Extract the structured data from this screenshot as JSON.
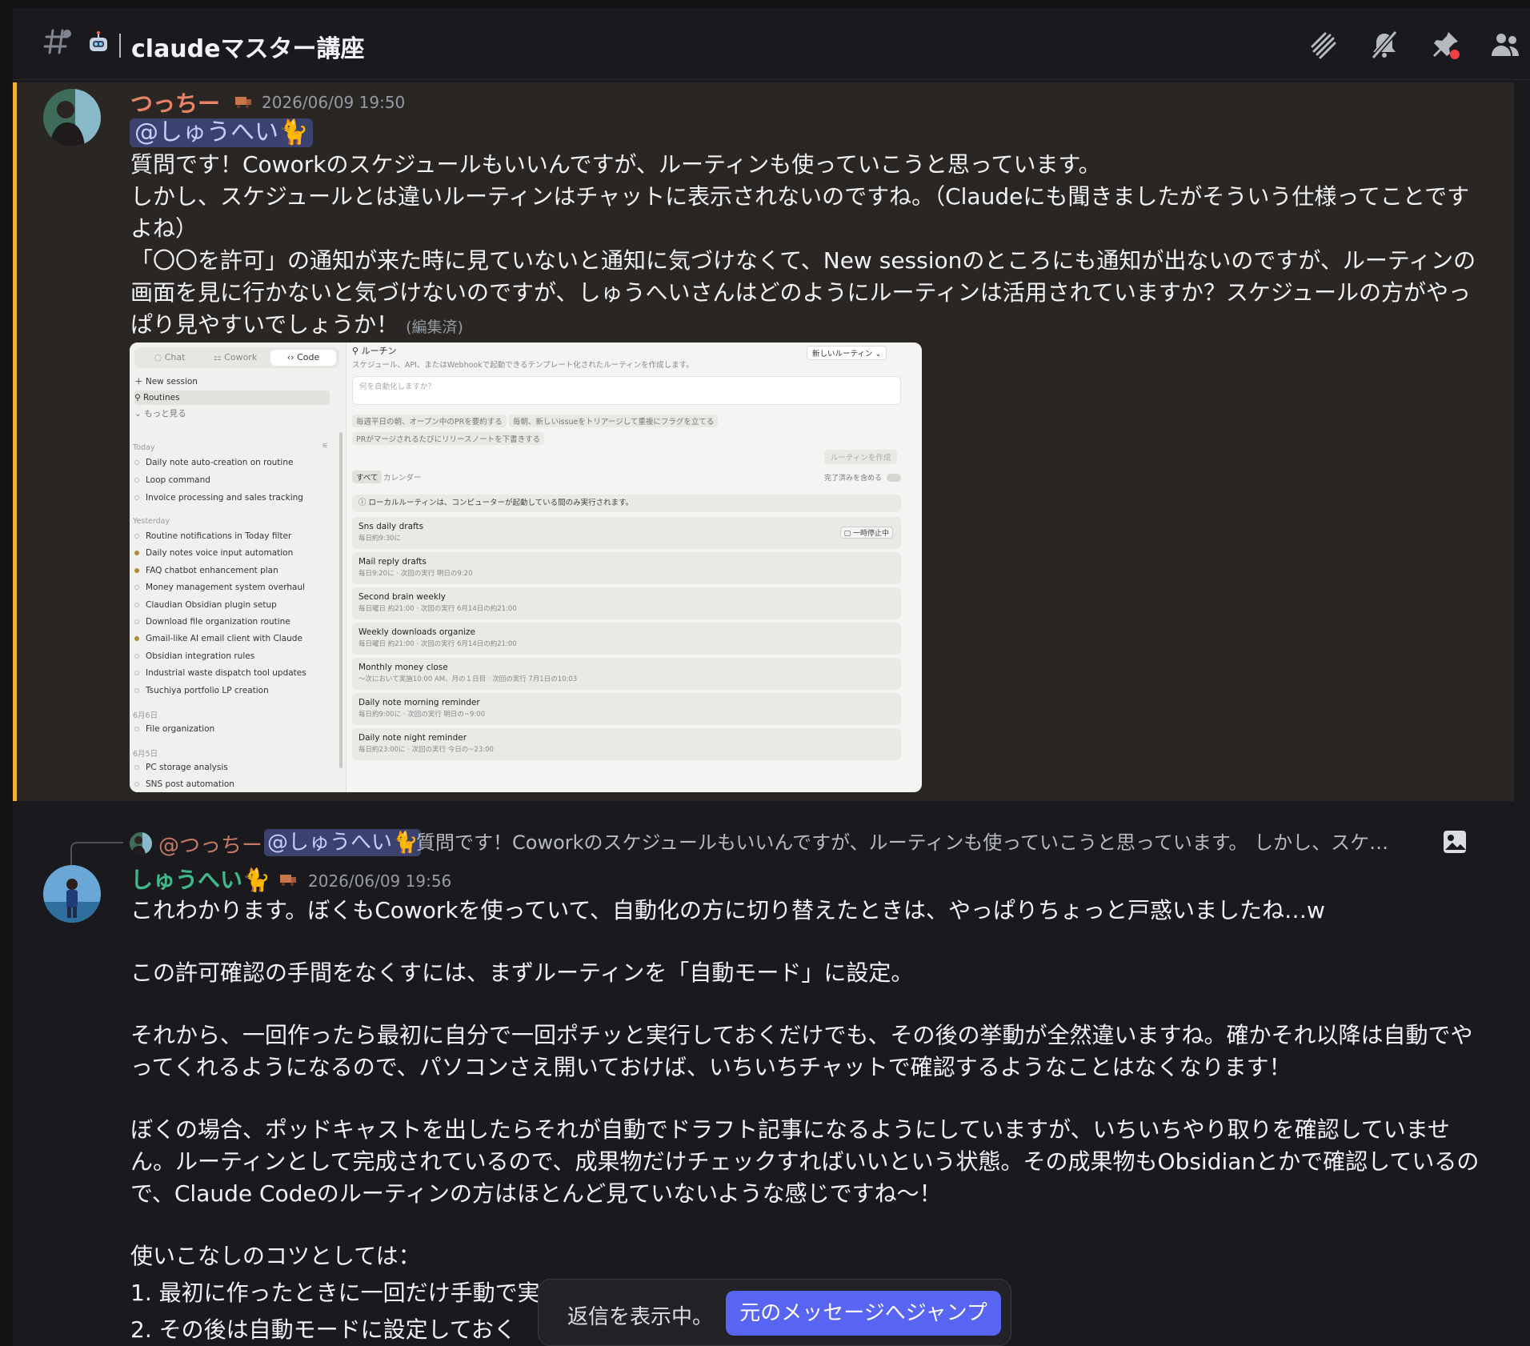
{
  "channel": {
    "name": "claudeマスター講座",
    "icons": [
      "hashtag-icon",
      "robot-icon",
      "threads-icon",
      "mute-icon",
      "pin-icon",
      "members-icon"
    ]
  },
  "message1": {
    "author": "つっちー",
    "timestamp": "2026/06/09 19:50",
    "mention": "@しゅうへい🐈",
    "lines": [
      "質問です！Coworkのスケジュールもいいんですが、ルーティンも使っていこうと思っています。",
      "しかし、スケジュールとは違いルーティンはチャットに表示されないのですね。（Claudeにも聞きましたがそういう仕様ってことですよね）",
      "「〇〇を許可」の通知が来た時に見ていないと通知に気づけなくて、New sessionのところにも通知が出ないのですが、ルーティンの画面を見に行かないと気づけないのですが、しゅうへいさんはどのようにルーティンは活用されていますか？スケジュールの方がやっぱり見やすいでしょうか！"
    ],
    "edited": "(編集済)",
    "accent_color": "#f0b232",
    "author_color": "#e8836a"
  },
  "screenshot": {
    "tabs": [
      "Chat",
      "Cowork",
      "Code"
    ],
    "nav": [
      "New session",
      "Routines",
      "もっと見る"
    ],
    "groups": [
      {
        "label": "Today",
        "items": [
          {
            "name": "Daily note auto-creation on routine",
            "filled": false
          },
          {
            "name": "Loop command",
            "filled": false
          },
          {
            "name": "Invoice processing and sales tracking",
            "filled": false
          }
        ]
      },
      {
        "label": "Yesterday",
        "items": [
          {
            "name": "Routine notifications in Today filter",
            "filled": false
          },
          {
            "name": "Daily notes voice input automation",
            "filled": true
          },
          {
            "name": "FAQ chatbot enhancement plan",
            "filled": true
          },
          {
            "name": "Money management system overhaul",
            "filled": false
          },
          {
            "name": "Claudian Obsidian plugin setup",
            "filled": false
          },
          {
            "name": "Download file organization routine",
            "filled": false
          },
          {
            "name": "Gmail-like AI email client with Claude",
            "filled": true
          },
          {
            "name": "Obsidian integration rules",
            "filled": false
          },
          {
            "name": "Industrial waste dispatch tool updates",
            "filled": false
          },
          {
            "name": "Tsuchiya portfolio LP creation",
            "filled": false
          }
        ]
      },
      {
        "label": "6月6日",
        "items": [
          {
            "name": "File organization",
            "filled": false
          }
        ]
      },
      {
        "label": "6月5日",
        "items": [
          {
            "name": "PC storage analysis",
            "filled": false
          },
          {
            "name": "SNS post automation",
            "filled": false
          }
        ]
      }
    ],
    "title": "ルーチン",
    "subtitle": "スケジュール、API、またはWebhookで起動できるテンプレート化されたルーティンを作成します。",
    "new_button": "新しいルーティン ⌄",
    "ask_placeholder": "何を自動化しますか？",
    "chips": [
      "毎週平日の朝、オープン中のPRを要約する",
      "毎朝、新しいissueをトリアージして重複にフラグを立てる",
      "PRがマージされるたびにリリースノートを下書きする"
    ],
    "create_button": "ルーティンを作成",
    "filter_tabs": [
      "すべて",
      "カレンダー"
    ],
    "include_done": "完了済みを含める",
    "notice": "ローカルルーティンは、コンピューターが起動している間のみ実行されます。",
    "routines": [
      {
        "name": "Sns daily drafts",
        "meta": "毎日約9:30に",
        "badge": "一時停止中"
      },
      {
        "name": "Mail reply drafts",
        "meta": "毎日9:20に · 次回の実行 明日の9:20",
        "badge": ""
      },
      {
        "name": "Second brain weekly",
        "meta": "毎日曜日 約21:00 · 次回の実行 6月14日の約21:00",
        "badge": ""
      },
      {
        "name": "Weekly downloads organize",
        "meta": "毎日曜日 約21:00 · 次回の実行 6月14日の約21:00",
        "badge": ""
      },
      {
        "name": "Monthly money close",
        "meta": "〜次において実施10:00 AM、月の１日目 · 次回の実行 7月1日の10:03",
        "badge": ""
      },
      {
        "name": "Daily note morning reminder",
        "meta": "毎日約9:00に · 次回の実行 明日の~9:00",
        "badge": ""
      },
      {
        "name": "Daily note night reminder",
        "meta": "毎日約23:00に · 次回の実行 今日の~23:00",
        "badge": ""
      }
    ]
  },
  "reply_ref": {
    "author": "@つっちー",
    "mention": "@しゅうへい🐈",
    "text": "質問です！Coworkのスケジュールもいいんですが、ルーティンも使っていこうと思っています。 しかし、スケ…"
  },
  "message2": {
    "author": "しゅうへい🐈",
    "timestamp": "2026/06/09 19:56",
    "author_color": "#3fb98a",
    "paragraphs": [
      "これわかります。ぼくもCoworkを使っていて、自動化の方に切り替えたときは、やっぱりちょっと戸惑いましたね…w",
      "この許可確認の手間をなくすには、まずルーティンを「自動モード」に設定。",
      "それから、一回作ったら最初に自分で一回ポチッと実行しておくだけでも、その後の挙動が全然違いますね。確かそれ以降は自動でやってくれるようになるので、パソコンさえ開いておけば、いちいちチャットで確認するようなことはなくなります！",
      "ぼくの場合、ポッドキャストを出したらそれが自動でドラフト記事になるようにしていますが、いちいちやり取りを確認していません。ルーティンとして完成されているので、成果物だけチェックすればいいという状態。その成果物もObsidianとかで確認しているので、Claude Codeのルーティンの方はほとんど見ていないような感じですね〜！",
      "使いこなしのコツとしては："
    ],
    "list": [
      "1. 最初に作ったときに一回だけ手動で実",
      "2. その後は自動モードに設定しておく"
    ]
  },
  "toast": {
    "text": "返信を表示中。",
    "button": "元のメッセージへジャンプ"
  },
  "colors": {
    "background": "#1a1a1e",
    "highlight": "#2a2623",
    "blurple": "#5865f2"
  }
}
